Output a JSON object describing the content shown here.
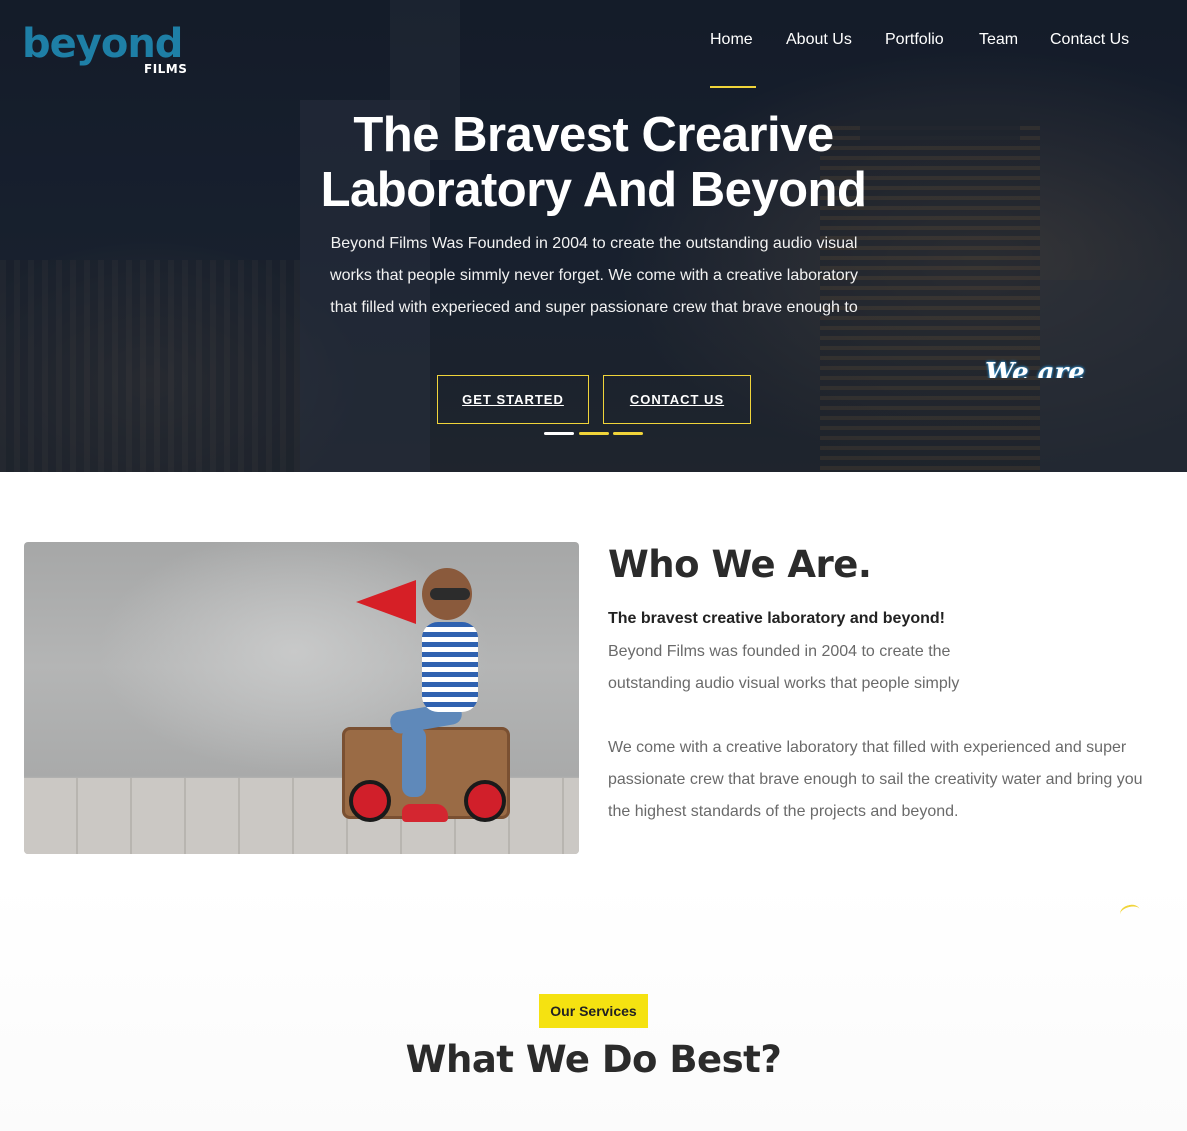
{
  "brand": {
    "name": "beyond",
    "sub": "FILMS",
    "color": "#1e7fa6"
  },
  "nav": {
    "items": [
      {
        "label": "Home",
        "active": true
      },
      {
        "label": "About Us"
      },
      {
        "label": "Portfolio"
      },
      {
        "label": "Team"
      },
      {
        "label": "Contact Us"
      }
    ]
  },
  "hero": {
    "title_line1": "The Bravest Crearive",
    "title_line2": "Laboratory And Beyond",
    "text": "Beyond Films Was Founded in 2004 to create the outstanding audio visual works that people simmly never forget. We come with a creative laboratory that filled with experieced and super passionare crew that brave enough to",
    "get_started": "GET STARTED",
    "contact_us": "CONTACT US",
    "slide_indicator": {
      "count": 3,
      "active_index": 0
    },
    "overlay_text": "We are",
    "accent_color": "#f0d43a"
  },
  "who": {
    "title": "Who We Are.",
    "subtitle": "The bravest creative laboratory and beyond!",
    "paragraph1": "Beyond Films was founded in 2004 to create the outstanding audio visual works that people simply never forget.",
    "paragraph2": "We come with a creative laboratory that filled with experienced and super passionate crew that brave enough to sail the creativity water and bring you the highest standards of the projects and beyond."
  },
  "services": {
    "badge": "Our Services",
    "title": "What We Do Best?",
    "badge_color": "#f5e211"
  }
}
